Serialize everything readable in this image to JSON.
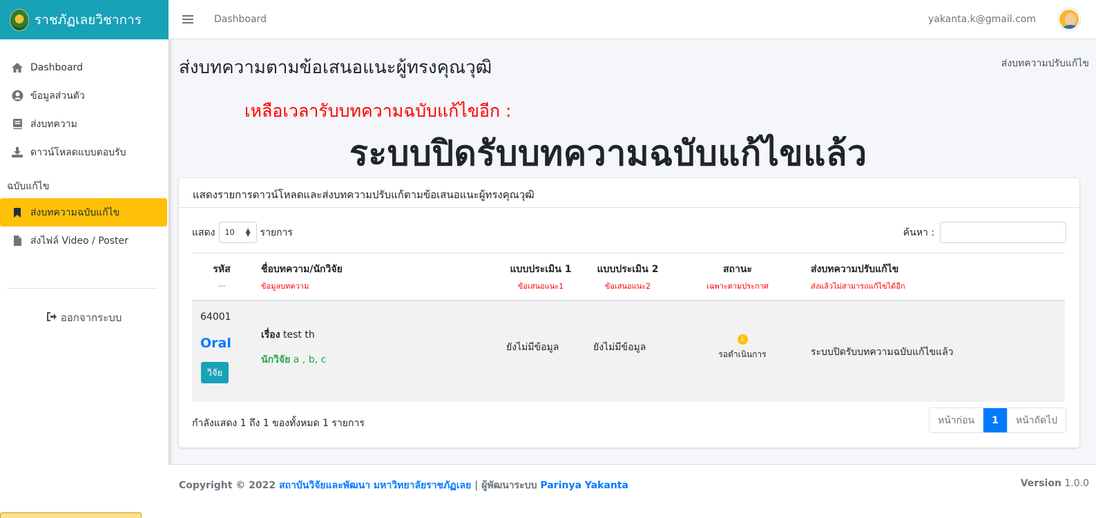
{
  "brand": {
    "title": "ราชภัฏเลยวิชาการ"
  },
  "sidebar": {
    "items": [
      {
        "label": "Dashboard",
        "icon": "home-icon"
      },
      {
        "label": "ข้อมูลส่วนตัว",
        "icon": "user-circle-icon"
      },
      {
        "label": "ส่งบทความ",
        "icon": "book-icon"
      },
      {
        "label": "ดาวน์โหลดแบบตอบรับ",
        "icon": "download-icon"
      }
    ],
    "section_header": "ฉบับแก้ไข",
    "section_items": [
      {
        "label": "ส่งบทความฉบับแก้ไข",
        "icon": "bookmark-icon",
        "active": true
      },
      {
        "label": "ส่งไฟล์ Video / Poster",
        "icon": "file-icon"
      }
    ],
    "logout_label": "ออกจากระบบ"
  },
  "topbar": {
    "breadcrumb": "Dashboard",
    "email": "yakanta.k@gmail.com"
  },
  "page": {
    "title": "ส่งบทความตามข้อเสนอแนะผู้ทรงคุณวุฒิ",
    "crumb": "ส่งบทความปรับแก้ไข",
    "countdown_label": "เหลือเวลารับบทความฉบับแก้ไขอีก :",
    "closed_message": "ระบบปิดรับบทความฉบับแก้ไขแล้ว"
  },
  "card": {
    "header": "แสดงรายการดาวน์โหลดและส่งบทความปรับแก้ตามข้อเสนอแนะผู้ทรงคุณวุฒิ",
    "show_label": "แสดง",
    "page_length": "10",
    "entries_label": "รายการ",
    "search_label": "ค้นหา :",
    "columns": [
      {
        "title": "รหัส",
        "sub": "..."
      },
      {
        "title": "ชื่อบทความ/นักวิจัย",
        "sub": "ข้อมูลบทความ"
      },
      {
        "title": "แบบประเมิน 1",
        "sub": "ข้อเสนอแนะ1"
      },
      {
        "title": "แบบประเมิน 2",
        "sub": "ข้อเสนอแนะ2"
      },
      {
        "title": "สถานะ",
        "sub": "เฉพาะตามประกาศ"
      },
      {
        "title": "ส่งบทความปรับแก้ไข",
        "sub": "ส่งแล้วไม่สามารถแก้ไขได้อีก"
      }
    ],
    "rows": [
      {
        "code": "64001",
        "type": "Oral",
        "category": "วิจัย",
        "title_label": "เรื่อง",
        "title": "test th",
        "authors_label": "นักวิจัย",
        "authors": "a , b, c",
        "eval1": "ยังไม่มีข้อมูล",
        "eval2": "ยังไม่มีข้อมูล",
        "status": "รอดำเนินการ",
        "revise": "ระบบปิดรับบทความฉบับแก้ไขแล้ว"
      }
    ],
    "info": "กำลังแสดง 1 ถึง 1 ของทั้งหมด 1 รายการ",
    "pager": {
      "prev": "หน้าก่อน",
      "current": "1",
      "next": "หน้าถัดไป"
    }
  },
  "footer": {
    "copyright": "Copyright © 2022",
    "org": "สถาบันวิจัยและพัฒนา มหาวิทยาลัยราชภัฏเลย",
    "dev_label": "| ผู้พัฒนาระบบ",
    "developer": "Parinya Yakanta",
    "version_label": "Version",
    "version": "1.0.0"
  },
  "colors": {
    "brand": "#17a2b8",
    "active": "#ffc107",
    "primary": "#007bff",
    "danger": "#ff0000",
    "success": "#28a745"
  }
}
